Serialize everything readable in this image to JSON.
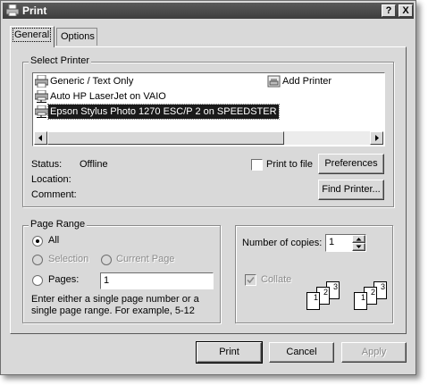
{
  "window": {
    "title": "Print",
    "help_button": "?",
    "close_button": "X"
  },
  "tabs": [
    {
      "label": "General"
    },
    {
      "label": "Options"
    }
  ],
  "select_printer": {
    "legend": "Select Printer",
    "printers": [
      {
        "name": "Generic / Text Only",
        "icon": "printer-icon"
      },
      {
        "name": "Auto HP LaserJet on VAIO",
        "icon": "network-printer-icon"
      },
      {
        "name": "Epson Stylus Photo 1270 ESC/P 2 on SPEEDSTER",
        "icon": "network-printer-icon",
        "selected": true
      }
    ],
    "add_printer": "Add Printer",
    "status_label": "Status:",
    "status_value": "Offline",
    "location_label": "Location:",
    "location_value": "",
    "comment_label": "Comment:",
    "comment_value": "",
    "print_to_file": "Print to file",
    "preferences_button": "Preferences",
    "find_printer_button": "Find Printer..."
  },
  "page_range": {
    "legend": "Page Range",
    "all": "All",
    "selection": "Selection",
    "current_page": "Current Page",
    "pages": "Pages:",
    "pages_value": "1",
    "hint": "Enter either a single page number or a single page range.  For example, 5-12"
  },
  "copies": {
    "label": "Number of copies:",
    "value": "1",
    "collate": "Collate",
    "collate_icon_pages": [
      "1",
      "2",
      "3"
    ]
  },
  "footer": {
    "print_button": "Print",
    "cancel_button": "Cancel",
    "apply_button": "Apply"
  }
}
